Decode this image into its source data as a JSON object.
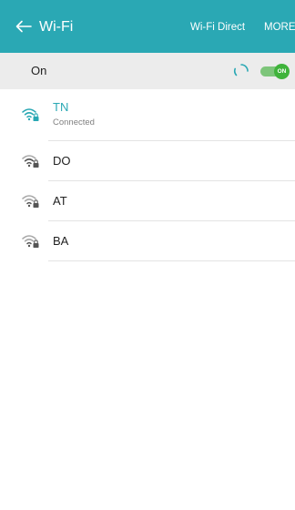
{
  "appbar": {
    "title": "Wi-Fi",
    "wifi_direct_label": "Wi-Fi Direct",
    "more_label": "MORE",
    "background_color": "#2aa8b4"
  },
  "master_switch": {
    "label": "On",
    "toggle_label": "ON",
    "toggle_color": "#3fb33b",
    "state": "on",
    "scanning": true
  },
  "networks": [
    {
      "name": "TN",
      "status": "Connected",
      "connected": true,
      "secured": true
    },
    {
      "name": "DO",
      "status": "",
      "connected": false,
      "secured": true
    },
    {
      "name": "AT",
      "status": "",
      "connected": false,
      "secured": true
    },
    {
      "name": "BA",
      "status": "",
      "connected": false,
      "secured": true
    }
  ]
}
